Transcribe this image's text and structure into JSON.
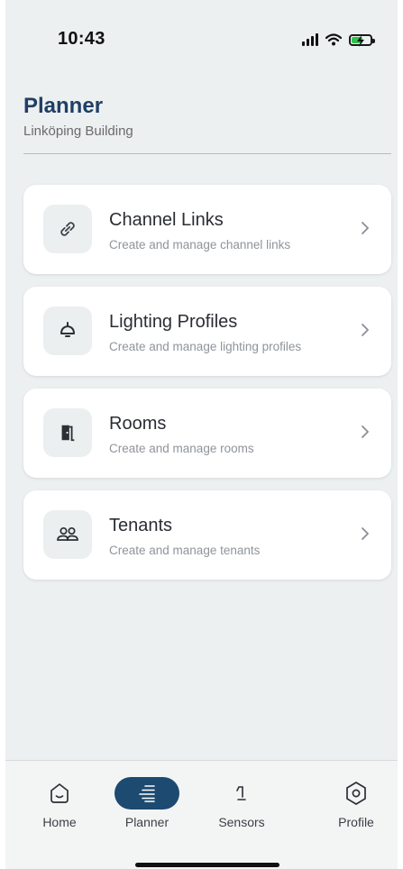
{
  "status_bar": {
    "time": "10:43"
  },
  "header": {
    "title": "Planner",
    "subtitle": "Linköping Building"
  },
  "cards": [
    {
      "title": "Channel Links",
      "description": "Create and manage channel links",
      "icon": "link-icon"
    },
    {
      "title": "Lighting Profiles",
      "description": "Create and manage lighting profiles",
      "icon": "ceiling-lamp-icon"
    },
    {
      "title": "Rooms",
      "description": "Create and manage rooms",
      "icon": "door-icon"
    },
    {
      "title": "Tenants",
      "description": "Create and manage tenants",
      "icon": "people-icon"
    }
  ],
  "tab_bar": {
    "tabs": [
      {
        "label": "Home",
        "icon": "home-icon",
        "active": false
      },
      {
        "label": "Planner",
        "icon": "list-icon",
        "active": true
      },
      {
        "label": "Sensors",
        "icon": "sensor-icon",
        "active": false
      },
      {
        "label": "Profile",
        "icon": "settings-hexagon-icon",
        "active": false
      }
    ]
  },
  "colors": {
    "background": "#edf0f0",
    "title": "#1f3f66",
    "active_tab": "#1d4a70",
    "battery": "#2ec34a"
  }
}
